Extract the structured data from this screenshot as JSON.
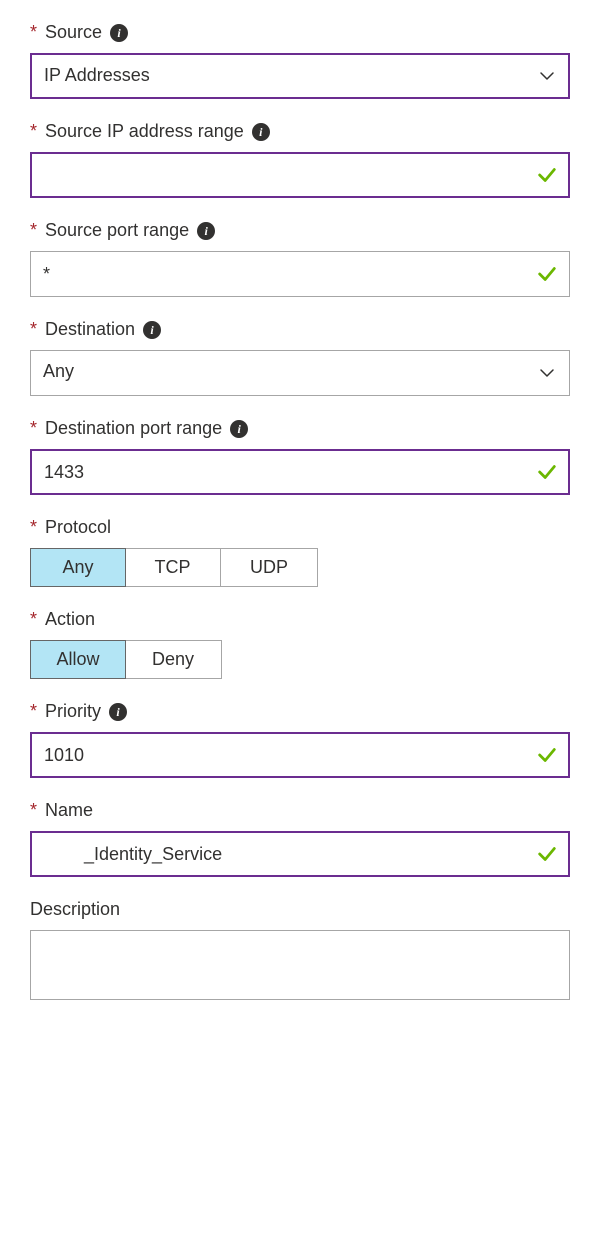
{
  "fields": {
    "source": {
      "label": "Source",
      "value": "IP Addresses"
    },
    "sourceIpRange": {
      "label": "Source IP address range",
      "value": ""
    },
    "sourcePortRange": {
      "label": "Source port range",
      "value": "*"
    },
    "destination": {
      "label": "Destination",
      "value": "Any"
    },
    "destinationPortRange": {
      "label": "Destination port range",
      "value": "1433"
    },
    "protocol": {
      "label": "Protocol",
      "options": {
        "any": "Any",
        "tcp": "TCP",
        "udp": "UDP"
      },
      "selected": "any"
    },
    "action": {
      "label": "Action",
      "options": {
        "allow": "Allow",
        "deny": "Deny"
      },
      "selected": "allow"
    },
    "priority": {
      "label": "Priority",
      "value": "1010"
    },
    "name": {
      "label": "Name",
      "value": "        _Identity_Service"
    },
    "description": {
      "label": "Description",
      "value": ""
    }
  }
}
